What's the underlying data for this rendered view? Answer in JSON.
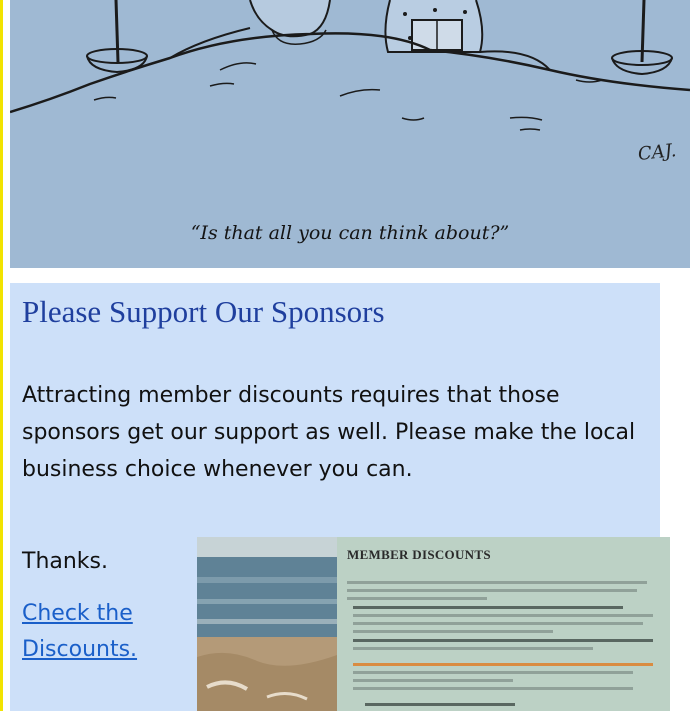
{
  "cartoon": {
    "caption": "“Is that all you can think about?”",
    "signature": "CAJ."
  },
  "sponsors": {
    "title": "Please Support Our Sponsors",
    "body": "Attracting member discounts requires that those sponsors get our support as well.  Please make the local business choice whenever you can.",
    "thanks": "Thanks.",
    "link_text": "Check the Discounts."
  },
  "thumbnail": {
    "heading": "MEMBER DISCOUNTS"
  },
  "colors": {
    "panel_bg": "#cde0f9",
    "title_blue": "#1f3f9e",
    "link_blue": "#1a5fc9",
    "left_rule": "#f2e300"
  }
}
